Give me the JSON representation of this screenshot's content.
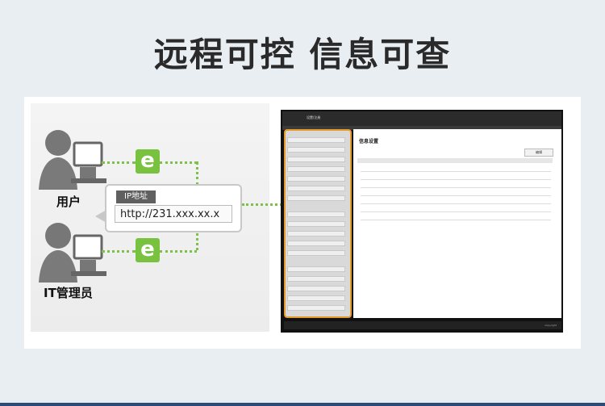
{
  "headline": "远程可控 信息可查",
  "users": [
    {
      "label": "用户"
    },
    {
      "label": "IT管理员"
    }
  ],
  "bubble": {
    "tag": "IP地址",
    "url": "http://231.xxx.xx.x"
  },
  "browser_icon": "e",
  "screen": {
    "title": "设置/注册",
    "page_title": "信息设置",
    "edit_button": "编辑",
    "footer": "Copyright"
  },
  "colors": {
    "accent_green": "#78c240",
    "highlight_orange": "#e59a2a"
  }
}
